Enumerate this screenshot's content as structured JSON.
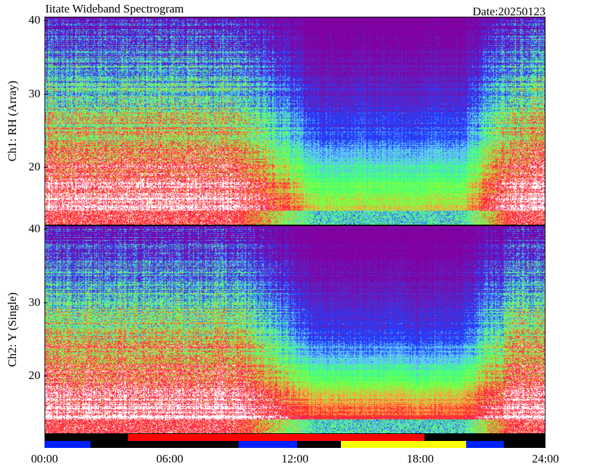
{
  "header": {
    "title": "Iitate Wideband Spectrogram",
    "date": "Date:20250123"
  },
  "chart_data": [
    {
      "type": "heatmap",
      "ylabel": "Ch1: RH (Array)",
      "yticks": [
        "20",
        "30",
        "40"
      ],
      "ylim": [
        12,
        40.5
      ],
      "xlim": [
        "00:00",
        "24:00"
      ],
      "xticks": [
        "00:00",
        "06:00",
        "12:00",
        "18:00",
        "24:00"
      ],
      "colormap": [
        "#ffffff",
        "#ff2060",
        "#ff3030",
        "#ffa040",
        "#80ff40",
        "#40ff80",
        "#60c0ff",
        "#2040ff",
        "#6020c0",
        "#8000a0"
      ]
    },
    {
      "type": "heatmap",
      "ylabel": "Ch2: Y (Single)",
      "yticks": [
        "20",
        "30",
        "40"
      ],
      "ylim": [
        12,
        40.5
      ],
      "xlim": [
        "00:00",
        "24:00"
      ],
      "xticks": [
        "00:00",
        "06:00",
        "12:00",
        "18:00",
        "24:00"
      ],
      "colormap": [
        "#ffffff",
        "#ff2060",
        "#ff3030",
        "#ffa040",
        "#80ff40",
        "#40ff80",
        "#60c0ff",
        "#2040ff",
        "#6020c0",
        "#8000a0"
      ]
    }
  ],
  "status_bar": {
    "segments": [
      {
        "start": 0.0,
        "end": 2.2,
        "color": "#0020ff",
        "row": "lower"
      },
      {
        "start": 4.0,
        "end": 18.2,
        "color": "#ff0000",
        "row": "upper"
      },
      {
        "start": 9.3,
        "end": 12.1,
        "color": "#0020ff",
        "row": "lower"
      },
      {
        "start": 14.2,
        "end": 20.2,
        "color": "#ffff00",
        "row": "lower"
      },
      {
        "start": 20.2,
        "end": 22.0,
        "color": "#0020ff",
        "row": "lower"
      }
    ]
  },
  "xaxis": {
    "ticks": [
      "00:00",
      "06:00",
      "12:00",
      "18:00",
      "24:00"
    ]
  }
}
